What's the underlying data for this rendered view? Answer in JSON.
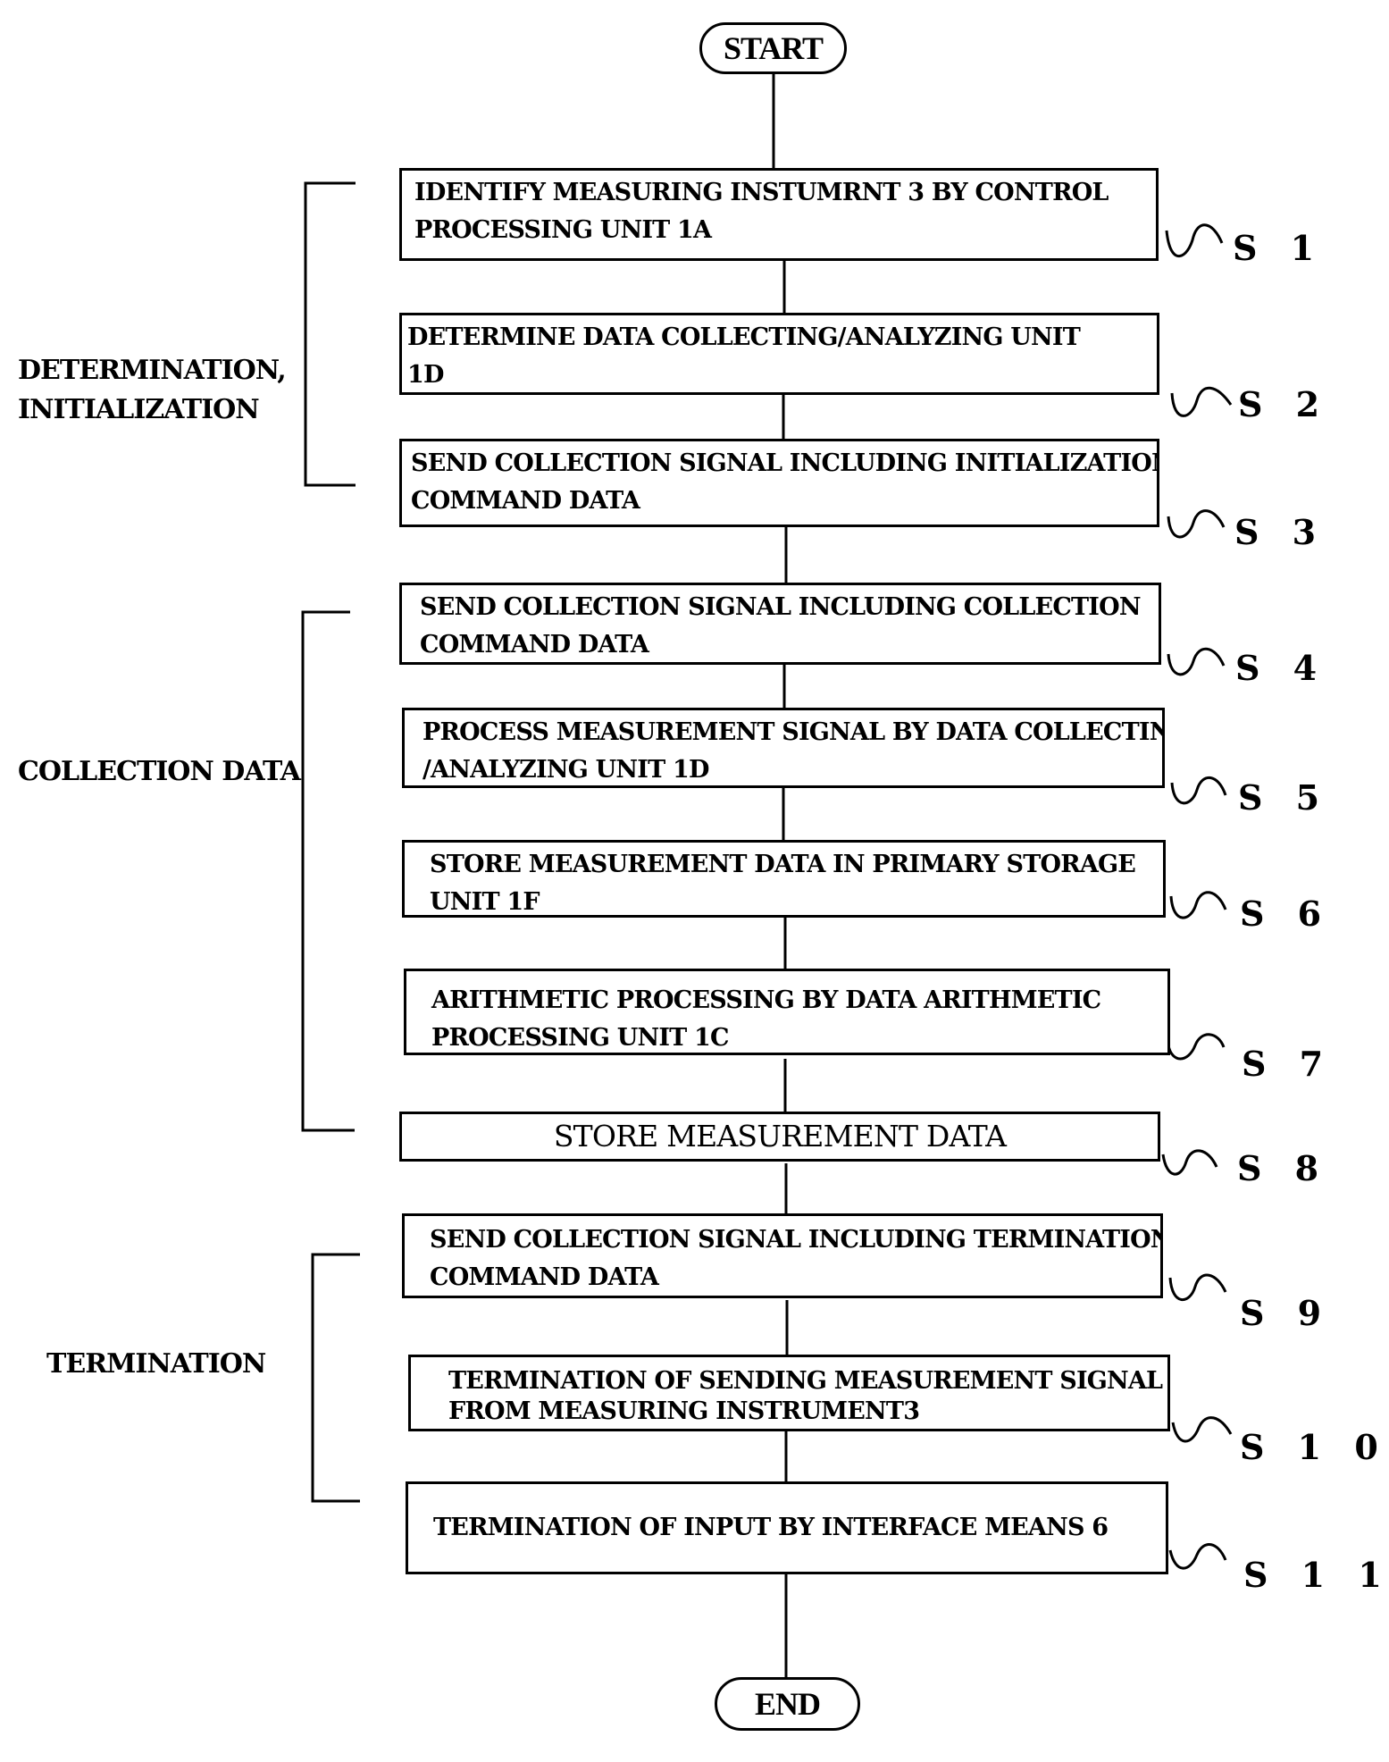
{
  "figure": {
    "start_label": "START",
    "end_label": "END",
    "groups": [
      {
        "id": "determination",
        "lines": [
          "DETERMINATION,",
          "INITIALIZATION"
        ]
      },
      {
        "id": "collection",
        "lines": [
          "COLLECTION DATA"
        ]
      },
      {
        "id": "termination",
        "lines": [
          "TERMINATION"
        ]
      }
    ],
    "steps": [
      {
        "id": "S1",
        "label": "S 1",
        "lines": [
          "IDENTIFY MEASURING INSTUMRNT 3 BY CONTROL",
          "PROCESSING UNIT 1A"
        ]
      },
      {
        "id": "S2",
        "label": "S 2",
        "lines": [
          "DETERMINE DATA COLLECTING/ANALYZING UNIT",
          "1D"
        ]
      },
      {
        "id": "S3",
        "label": "S 3",
        "lines": [
          "SEND COLLECTION SIGNAL INCLUDING INITIALIZATION",
          "COMMAND DATA"
        ]
      },
      {
        "id": "S4",
        "label": "S 4",
        "lines": [
          "SEND COLLECTION SIGNAL INCLUDING COLLECTION",
          "COMMAND DATA"
        ]
      },
      {
        "id": "S5",
        "label": "S 5",
        "lines": [
          "PROCESS MEASUREMENT SIGNAL BY DATA COLLECTING",
          "/ANALYZING UNIT 1D"
        ]
      },
      {
        "id": "S6",
        "label": "S 6",
        "lines": [
          "STORE MEASUREMENT DATA IN PRIMARY STORAGE",
          "UNIT 1F"
        ]
      },
      {
        "id": "S7",
        "label": "S 7",
        "lines": [
          "ARITHMETIC PROCESSING BY DATA ARITHMETIC",
          "PROCESSING UNIT 1C"
        ]
      },
      {
        "id": "S8",
        "label": "S 8",
        "lines": [
          "STORE MEASUREMENT DATA"
        ]
      },
      {
        "id": "S9",
        "label": "S 9",
        "lines": [
          "SEND COLLECTION SIGNAL INCLUDING TERMINATION",
          "COMMAND DATA"
        ]
      },
      {
        "id": "S10",
        "label": "S 1 0",
        "lines": [
          "TERMINATION OF SENDING MEASUREMENT SIGNAL",
          "FROM MEASURING INSTRUMENT3"
        ]
      },
      {
        "id": "S11",
        "label": "S 1 1",
        "lines": [
          "TERMINATION OF INPUT BY INTERFACE MEANS 6"
        ]
      }
    ]
  }
}
